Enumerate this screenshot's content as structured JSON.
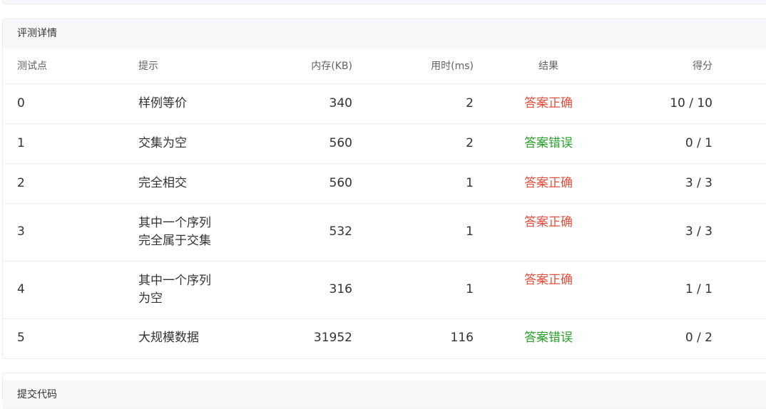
{
  "panel_title": "评测详情",
  "next_panel_title": "提交代码",
  "columns": {
    "case": "测试点",
    "hint": "提示",
    "memory": "内存(KB)",
    "time": "用时(ms)",
    "result": "结果",
    "score": "得分"
  },
  "rows": [
    {
      "case": "0",
      "hint_lines": [
        "样例等价"
      ],
      "memory": "340",
      "time": "2",
      "result": "答案正确",
      "status": "accepted",
      "score": "10 / 10"
    },
    {
      "case": "1",
      "hint_lines": [
        "交集为空"
      ],
      "memory": "560",
      "time": "2",
      "result": "答案错误",
      "status": "wrong",
      "score": "0 / 1"
    },
    {
      "case": "2",
      "hint_lines": [
        "完全相交"
      ],
      "memory": "560",
      "time": "1",
      "result": "答案正确",
      "status": "accepted",
      "score": "3 / 3"
    },
    {
      "case": "3",
      "hint_lines": [
        "其中一个序列",
        "完全属于交集"
      ],
      "memory": "532",
      "time": "1",
      "result": "答案正确",
      "status": "accepted",
      "score": "3 / 3"
    },
    {
      "case": "4",
      "hint_lines": [
        "其中一个序列",
        "为空"
      ],
      "memory": "316",
      "time": "1",
      "result": "答案正确",
      "status": "accepted",
      "score": "1 / 1"
    },
    {
      "case": "5",
      "hint_lines": [
        "大规模数据"
      ],
      "memory": "31952",
      "time": "116",
      "result": "答案错误",
      "status": "wrong",
      "score": "0 / 2"
    }
  ],
  "colors": {
    "accepted": "#e74c3c",
    "wrong": "#27a127"
  }
}
